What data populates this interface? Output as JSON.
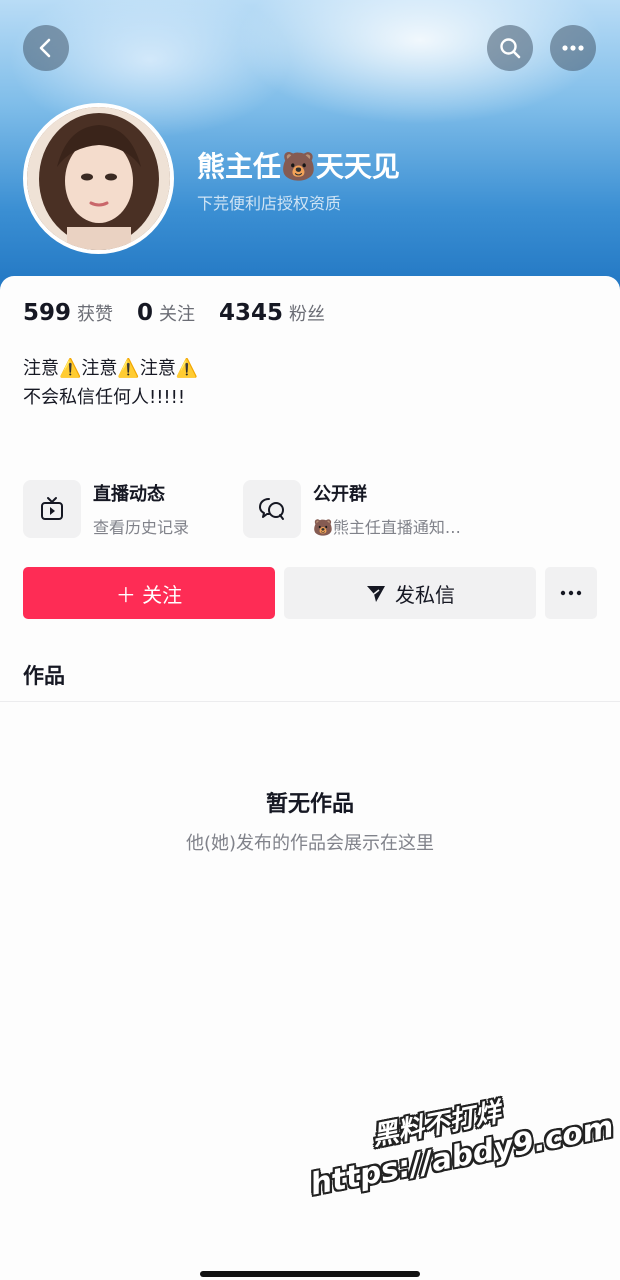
{
  "header": {
    "nickname": "熊主任🐻天天见",
    "subtitle": "下芫便利店授权资质"
  },
  "icons": {
    "back": "chevron-left-icon",
    "search": "search-icon",
    "more": "more-horizontal-icon"
  },
  "stats": [
    {
      "value": "599",
      "label": "获赞"
    },
    {
      "value": "0",
      "label": "关注"
    },
    {
      "value": "4345",
      "label": "粉丝"
    }
  ],
  "bio": {
    "line1_parts": [
      "注意",
      "⚠️",
      "注意",
      "⚠️",
      "注意",
      "⚠️"
    ],
    "line2": "不会私信任何人!!!!!"
  },
  "cards": {
    "live": {
      "title": "直播动态",
      "subtitle": "查看历史记录"
    },
    "group": {
      "title": "公开群",
      "subtitle": "🐻熊主任直播通知…"
    }
  },
  "actions": {
    "follow": "＋ 关注",
    "message": "发私信"
  },
  "works": {
    "tab_label": "作品",
    "empty_title": "暂无作品",
    "empty_subtitle": "他(她)发布的作品会展示在这里"
  },
  "watermark": {
    "line1": "黑料不打烊",
    "line2": "https://abdy9.com"
  },
  "colors": {
    "follow_button": "#fe2c55",
    "secondary_button": "#f1f1f2",
    "header_blue": "#1f74c1"
  }
}
